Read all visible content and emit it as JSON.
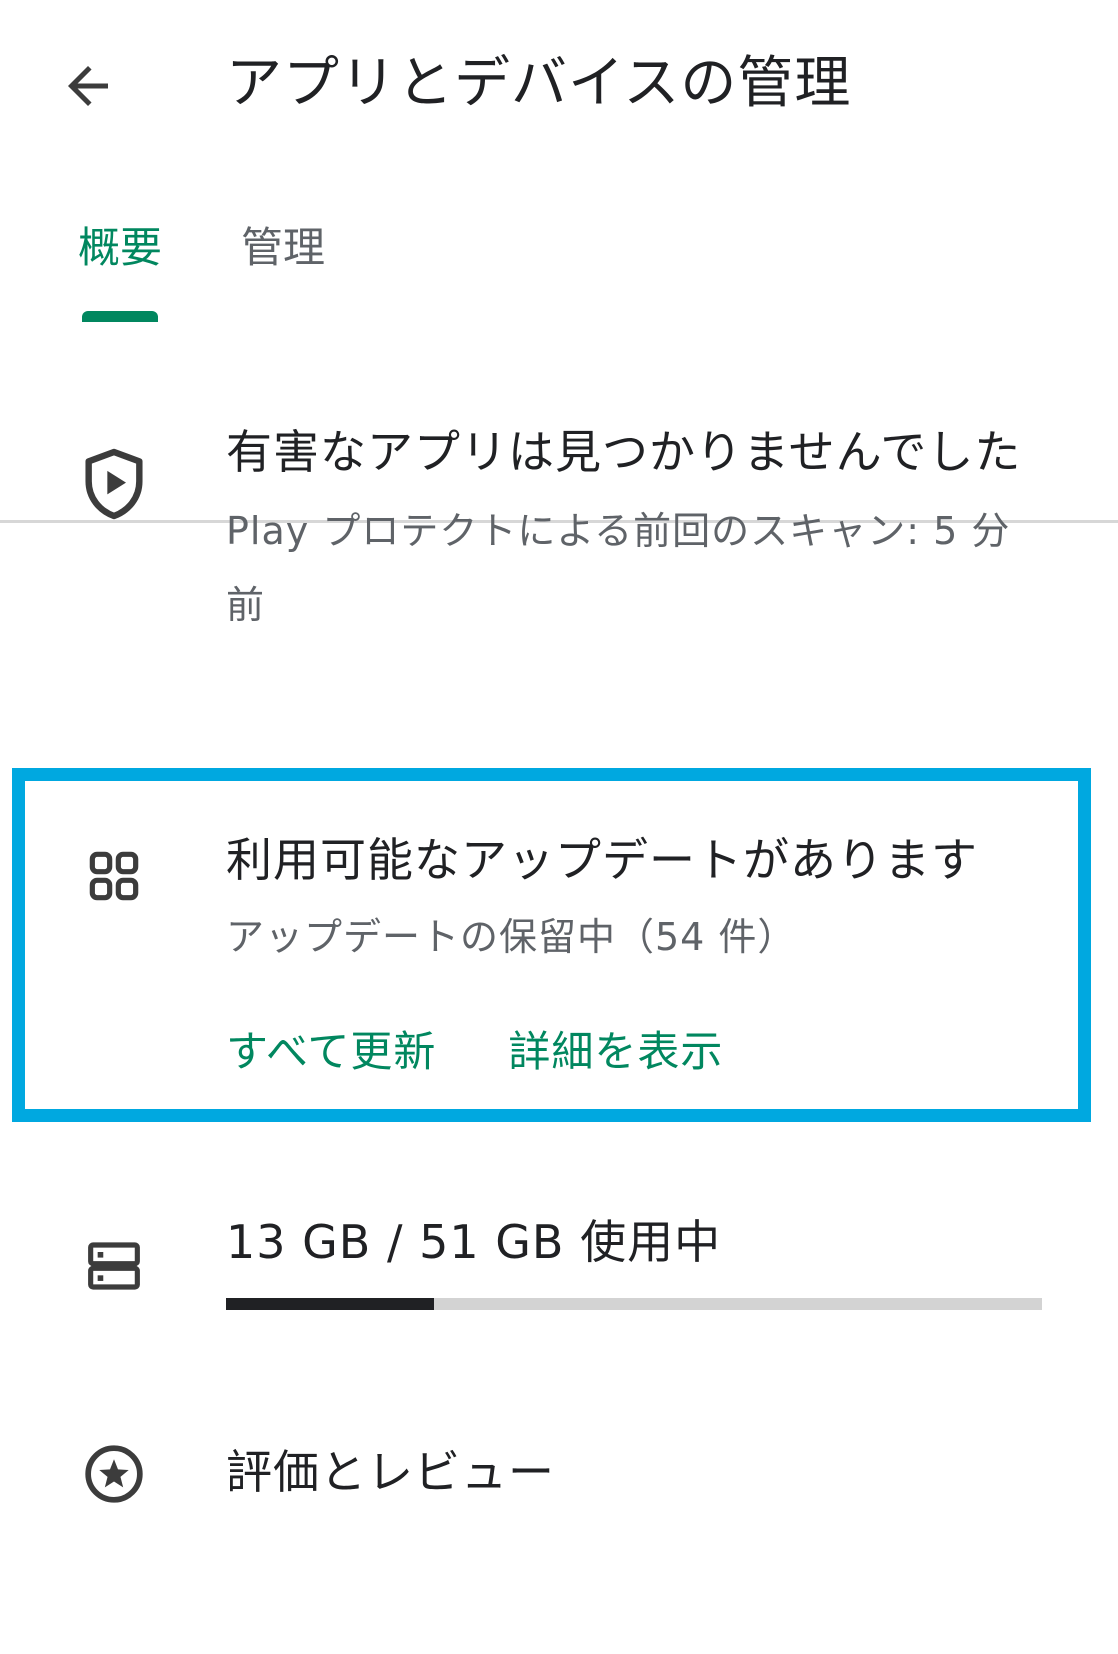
{
  "header": {
    "title": "アプリとデバイスの管理",
    "back_icon": "arrow-back-icon"
  },
  "tabs": [
    {
      "label": "概要",
      "selected": true
    },
    {
      "label": "管理",
      "selected": false
    }
  ],
  "colors": {
    "accent": "#01875f",
    "highlight_border": "#00a8e0",
    "progress_track": "#d3d3d3",
    "progress_fill": "#202124"
  },
  "protect": {
    "icon": "shield-play-icon",
    "title": "有害なアプリは見つかりませんでした",
    "subtitle": "Play プロテクトによる前回のスキャン: 5 分前"
  },
  "updates": {
    "icon": "apps-grid-icon",
    "title": "利用可能なアップデートがあります",
    "subtitle": "アップデートの保留中（54 件）",
    "update_all_label": "すべて更新",
    "details_label": "詳細を表示"
  },
  "storage": {
    "icon": "storage-icon",
    "label": "13 GB / 51 GB 使用中",
    "used_gb": 13,
    "total_gb": 51
  },
  "ratings": {
    "icon": "star-circle-icon",
    "label": "評価とレビュー"
  }
}
